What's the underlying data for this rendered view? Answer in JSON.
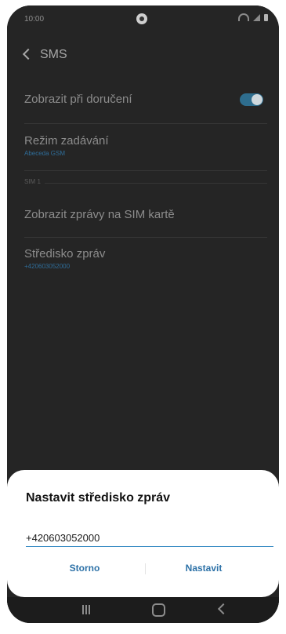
{
  "status_bar": {
    "time": "10:00"
  },
  "header": {
    "title": "SMS"
  },
  "settings": {
    "delivery": {
      "label": "Zobrazit při doručení",
      "enabled": true
    },
    "input_mode": {
      "label": "Režim zadávání",
      "value": "Abeceda GSM"
    },
    "section_label": "SIM 1",
    "sim_messages": {
      "label": "Zobrazit zprávy na SIM kartě"
    },
    "message_center": {
      "label": "Středisko zpráv",
      "value": "+420603052000"
    }
  },
  "dialog": {
    "title": "Nastavit středisko zpráv",
    "input_value": "+420603052000",
    "cancel_label": "Storno",
    "confirm_label": "Nastavit"
  },
  "colors": {
    "accent": "#2c71a7",
    "toggle_on": "#2e6d8e",
    "dialog_bg": "#ffffff"
  }
}
